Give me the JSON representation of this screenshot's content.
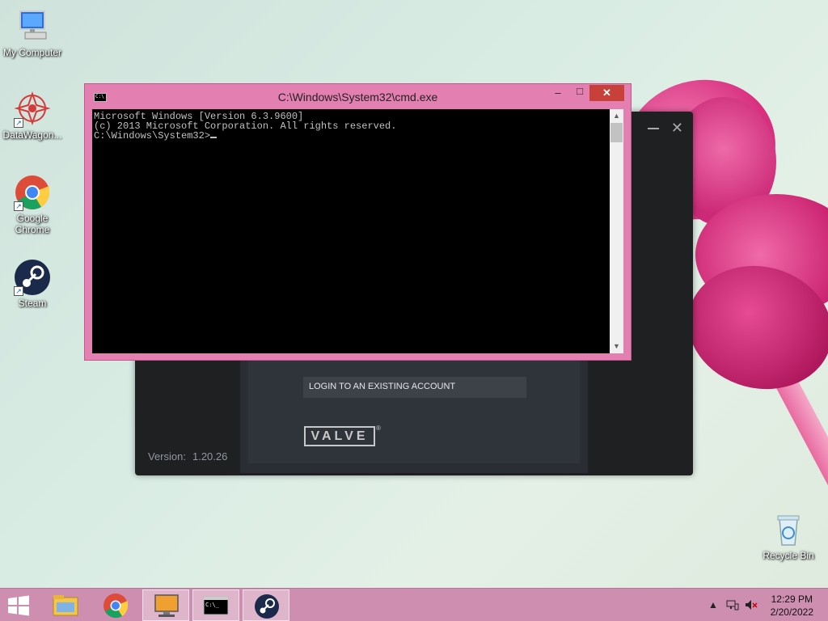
{
  "desktop": {
    "icons": [
      {
        "label": "My Computer"
      },
      {
        "label": "DataWagon..."
      },
      {
        "label": "Google Chrome"
      },
      {
        "label": "Steam"
      },
      {
        "label": "Recycle Bin"
      }
    ]
  },
  "steam": {
    "login_button": "LOGIN TO AN EXISTING ACCOUNT",
    "valve_logo": "VALVE",
    "version_label": "Version:",
    "version_value": "1.20.26"
  },
  "cmd": {
    "title": "C:\\Windows\\System32\\cmd.exe",
    "lines": [
      "Microsoft Windows [Version 6.3.9600]",
      "(c) 2013 Microsoft Corporation. All rights reserved.",
      "",
      "C:\\Windows\\System32>"
    ]
  },
  "taskbar": {
    "time": "12:29 PM",
    "date": "2/20/2022",
    "items": [
      "file-explorer",
      "google-chrome",
      "computer",
      "command-prompt",
      "steam"
    ],
    "active_item": "command-prompt"
  },
  "colors": {
    "cmd_frame": "#e47fb1",
    "taskbar": "#cd8eb0",
    "close_button": "#c7403a"
  }
}
